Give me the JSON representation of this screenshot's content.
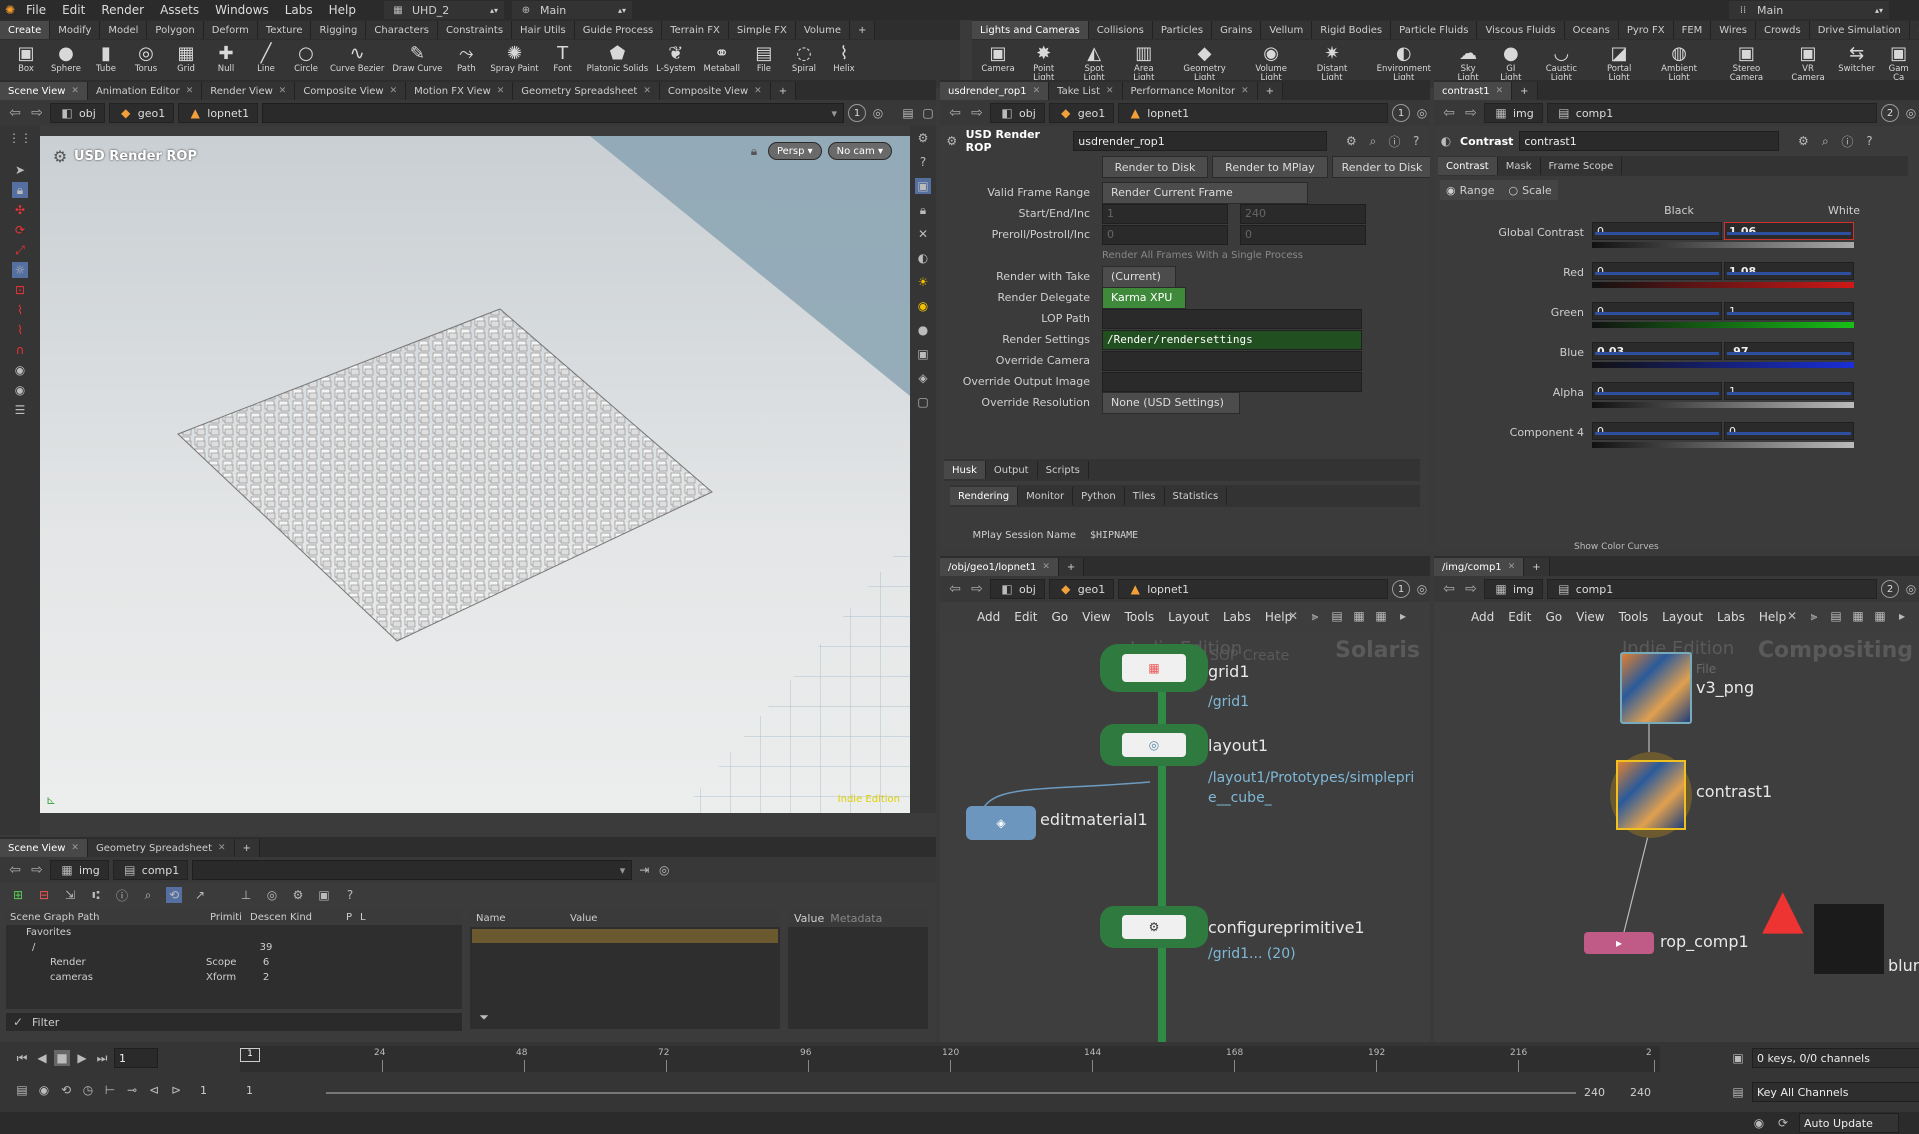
{
  "menubar": {
    "items": [
      "File",
      "Edit",
      "Render",
      "Assets",
      "Windows",
      "Labs",
      "Help"
    ],
    "desktop": "UHD_2",
    "network": "Main",
    "right_label": "Main"
  },
  "shelf_left": {
    "tabs": [
      "Create",
      "Modify",
      "Model",
      "Polygon",
      "Deform",
      "Texture",
      "Rigging",
      "Characters",
      "Constraints",
      "Hair Utils",
      "Guide Process",
      "Terrain FX",
      "Simple FX",
      "Volume"
    ],
    "tools": [
      {
        "label": "Box",
        "icon": "cube-icon"
      },
      {
        "label": "Sphere",
        "icon": "sphere-icon"
      },
      {
        "label": "Tube",
        "icon": "tube-icon"
      },
      {
        "label": "Torus",
        "icon": "torus-icon"
      },
      {
        "label": "Grid",
        "icon": "grid-icon"
      },
      {
        "label": "Null",
        "icon": "null-icon"
      },
      {
        "label": "Line",
        "icon": "line-icon"
      },
      {
        "label": "Circle",
        "icon": "circle-icon"
      },
      {
        "label": "Curve Bezier",
        "icon": "curve-icon"
      },
      {
        "label": "Draw Curve",
        "icon": "pen-icon"
      },
      {
        "label": "Path",
        "icon": "path-icon"
      },
      {
        "label": "Spray Paint",
        "icon": "spray-icon"
      },
      {
        "label": "Font",
        "icon": "font-icon"
      },
      {
        "label": "Platonic Solids",
        "icon": "platonic-icon"
      },
      {
        "label": "L-System",
        "icon": "lsystem-icon"
      },
      {
        "label": "Metaball",
        "icon": "metaball-icon"
      },
      {
        "label": "File",
        "icon": "file-icon"
      },
      {
        "label": "Spiral",
        "icon": "spiral-icon"
      },
      {
        "label": "Helix",
        "icon": "helix-icon"
      }
    ]
  },
  "shelf_right": {
    "tabs": [
      "Lights and Cameras",
      "Collisions",
      "Particles",
      "Grains",
      "Vellum",
      "Rigid Bodies",
      "Particle Fluids",
      "Viscous Fluids",
      "Oceans",
      "Pyro FX",
      "FEM",
      "Wires",
      "Crowds",
      "Drive Simulation"
    ],
    "tools": [
      {
        "label": "Camera",
        "icon": "camera-icon"
      },
      {
        "label": "Point Light",
        "icon": "point-light-icon"
      },
      {
        "label": "Spot Light",
        "icon": "spot-light-icon"
      },
      {
        "label": "Area Light",
        "icon": "area-light-icon"
      },
      {
        "label": "Geometry Light",
        "icon": "geo-light-icon"
      },
      {
        "label": "Volume Light",
        "icon": "volume-light-icon"
      },
      {
        "label": "Distant Light",
        "icon": "distant-light-icon"
      },
      {
        "label": "Environment Light",
        "icon": "env-light-icon"
      },
      {
        "label": "Sky Light",
        "icon": "sky-light-icon"
      },
      {
        "label": "GI Light",
        "icon": "gi-light-icon"
      },
      {
        "label": "Caustic Light",
        "icon": "caustic-light-icon"
      },
      {
        "label": "Portal Light",
        "icon": "portal-light-icon"
      },
      {
        "label": "Ambient Light",
        "icon": "ambient-light-icon"
      },
      {
        "label": "Stereo Camera",
        "icon": "stereo-camera-icon"
      },
      {
        "label": "VR Camera",
        "icon": "vr-camera-icon"
      },
      {
        "label": "Switcher",
        "icon": "switcher-icon"
      },
      {
        "label": "Gam Ca",
        "icon": "gamepad-camera-icon"
      }
    ]
  },
  "viewer": {
    "tabs": [
      "Scene View",
      "Animation Editor",
      "Render View",
      "Composite View",
      "Motion FX View",
      "Geometry Spreadsheet",
      "Composite View"
    ],
    "path": [
      "obj",
      "geo1",
      "lopnet1"
    ],
    "overlay_title": "USD Render ROP",
    "persp": "Persp",
    "cam": "No cam",
    "watermark": "Indie Edition",
    "counter": "1"
  },
  "scenegraph": {
    "tabs": [
      "Scene View",
      "Geometry Spreadsheet"
    ],
    "path": [
      "img",
      "comp1"
    ],
    "columns": [
      "Scene Graph Path",
      "Primiti",
      "Descen",
      "Kind",
      "P",
      "L"
    ],
    "rows": [
      {
        "name": "Favorites",
        "prim": "",
        "desc": "",
        "kind": ""
      },
      {
        "name": "/",
        "prim": "",
        "desc": "39",
        "kind": ""
      },
      {
        "name": "Render",
        "prim": "Scope",
        "desc": "6",
        "kind": ""
      },
      {
        "name": "cameras",
        "prim": "Xform",
        "desc": "2",
        "kind": ""
      }
    ],
    "filter": "Filter",
    "prop_cols": [
      "Name",
      "Value"
    ],
    "value_tab": "Value",
    "metadata_tab": "Metadata"
  },
  "rop": {
    "tabs": [
      "usdrender_rop1",
      "Take List",
      "Performance Monitor"
    ],
    "path": [
      "obj",
      "geo1",
      "lopnet1"
    ],
    "type": "USD Render ROP",
    "name": "usdrender_rop1",
    "buttons": [
      "Render to Disk",
      "Render to MPlay",
      "Render to Disk"
    ],
    "params": [
      {
        "label": "Valid Frame Range",
        "value": "Render Current Frame"
      },
      {
        "label": "Start/End/Inc",
        "value": "1",
        "v2": "240"
      },
      {
        "label": "Preroll/Postroll/Inc",
        "value": "0",
        "v2": "0"
      },
      {
        "label": "",
        "value": "Render All Frames With a Single Process"
      },
      {
        "label": "Render with Take",
        "value": "(Current)"
      },
      {
        "label": "Render Delegate",
        "value": "Karma XPU"
      },
      {
        "label": "LOP Path",
        "value": ""
      },
      {
        "label": "Render Settings",
        "value": "/Render/rendersettings"
      },
      {
        "label": "Override Camera",
        "value": ""
      },
      {
        "label": "Override Output Image",
        "value": ""
      },
      {
        "label": "Override Resolution",
        "value": "None (USD Settings)"
      }
    ],
    "subtabs": [
      "Husk",
      "Output",
      "Scripts"
    ],
    "subtabs2": [
      "Rendering",
      "Monitor",
      "Python",
      "Tiles",
      "Statistics"
    ],
    "mplay_label": "MPlay Session Name",
    "mplay_value": "$HIPNAME"
  },
  "contrast": {
    "tab": "contrast1",
    "path": [
      "img",
      "comp1"
    ],
    "counter": "2",
    "type": "Contrast",
    "name": "contrast1",
    "tabs": [
      "Contrast",
      "Mask",
      "Frame Scope"
    ],
    "range": "Range",
    "scale": "Scale",
    "col_black": "Black",
    "col_white": "White",
    "rows": [
      {
        "label": "Global Contrast",
        "black": "0",
        "white": "1.06",
        "color": "#aaaaaa"
      },
      {
        "label": "Red",
        "black": "0",
        "white": "1.08",
        "color": "#d01818"
      },
      {
        "label": "Green",
        "black": "0",
        "white": "1",
        "color": "#18c018"
      },
      {
        "label": "Blue",
        "black": "0.03",
        "white": ".97",
        "color": "#1a2fd8"
      },
      {
        "label": "Alpha",
        "black": "0",
        "white": "1",
        "color": "#bbbbbb"
      },
      {
        "label": "Component 4",
        "black": "0",
        "white": "0",
        "color": "#bbbbbb"
      }
    ],
    "footer": "Show Color Curves"
  },
  "solaris": {
    "tab": "/obj/geo1/lopnet1",
    "path": [
      "obj",
      "geo1",
      "lopnet1"
    ],
    "counter": "1",
    "menu": [
      "Add",
      "Edit",
      "Go",
      "View",
      "Tools",
      "Layout",
      "Labs",
      "Help"
    ],
    "edition": "Indie Edition",
    "context": "Solaris",
    "nodes": [
      {
        "name": "grid1",
        "type": "SOP Create",
        "sub": "/grid1"
      },
      {
        "name": "layout1",
        "type": "",
        "sub": "/layout1/Prototypes/simplepri",
        "sub2": "e__cube_"
      },
      {
        "name": "editmaterial1",
        "type": "",
        "sub": ""
      },
      {
        "name": "configureprimitive1",
        "type": "",
        "sub": "/grid1... (20)"
      }
    ]
  },
  "compositing": {
    "tab": "/img/comp1",
    "path": [
      "img",
      "comp1"
    ],
    "counter": "2",
    "menu": [
      "Add",
      "Edit",
      "Go",
      "View",
      "Tools",
      "Layout",
      "Labs",
      "Help"
    ],
    "edition": "Indie Edition",
    "context": "Compositing",
    "nodes": [
      {
        "name": "v3_png",
        "type": "File"
      },
      {
        "name": "contrast1",
        "type": ""
      },
      {
        "name": "rop_comp1",
        "type": ""
      },
      {
        "name": "blur",
        "type": ""
      }
    ]
  },
  "timeline": {
    "frame": "1",
    "ticks": [
      "24",
      "48",
      "72",
      "96",
      "120",
      "144",
      "168",
      "192",
      "216",
      "2"
    ],
    "start": "1",
    "start2": "1",
    "end": "240",
    "end2": "240",
    "keys": "0 keys, 0/0 channels",
    "key_all": "Key All Channels",
    "auto_update": "Auto Update"
  }
}
